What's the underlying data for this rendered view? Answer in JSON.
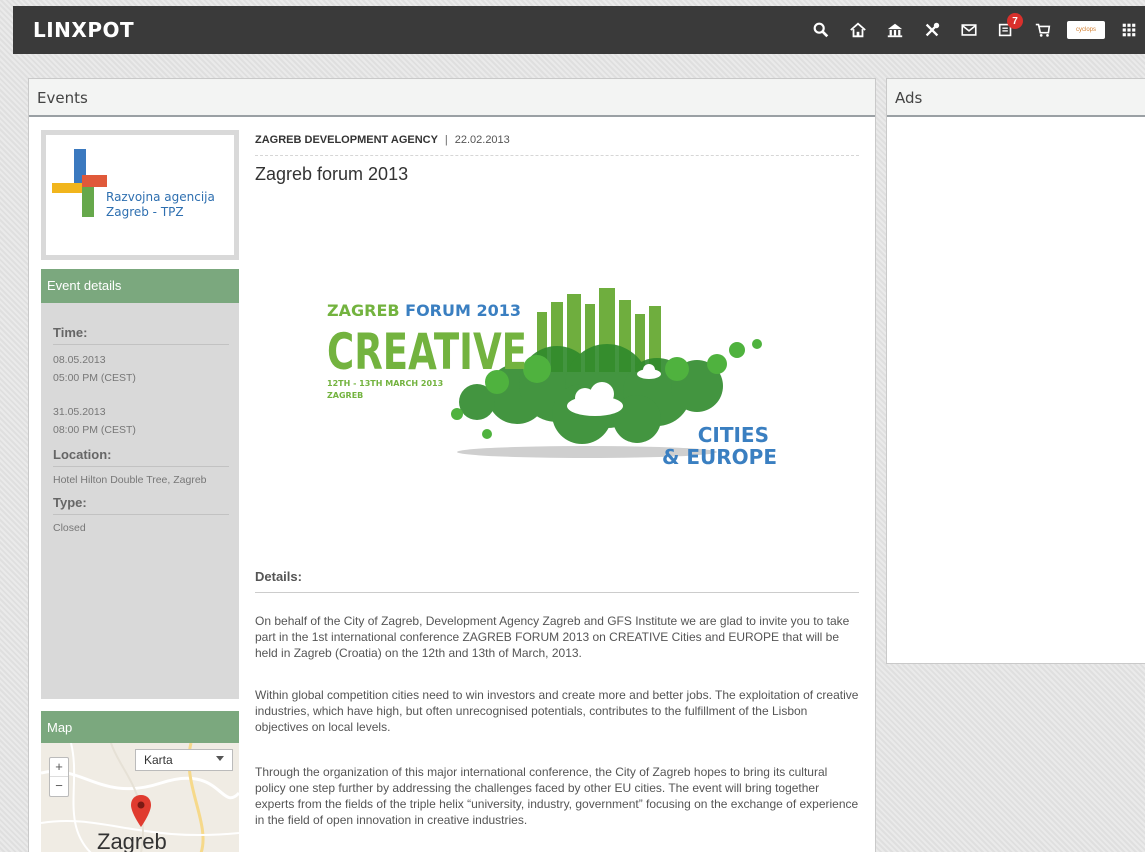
{
  "app": {
    "logo": "LINXPOT"
  },
  "topbar": {
    "icons": [
      "search-icon",
      "home-icon",
      "company-icon",
      "tools-icon",
      "mail-icon",
      "notifications-icon",
      "cart-icon",
      "cyclops-app",
      "apps-grid-icon"
    ],
    "notification_count": "7",
    "cyclops_label": "cyclops"
  },
  "events_panel": {
    "title": "Events",
    "organization_logo_text": [
      "Razvojna agencija",
      "Zagreb - TPZ"
    ],
    "event_details": {
      "heading": "Event details",
      "time_label": "Time:",
      "start_date": "08.05.2013",
      "start_time": "05:00 PM (CEST)",
      "end_date": "31.05.2013",
      "end_time": "08:00 PM (CEST)",
      "location_label": "Location:",
      "location_value": "Hotel Hilton Double Tree, Zagreb",
      "type_label": "Type:",
      "type_value": "Closed"
    },
    "map": {
      "heading": "Map",
      "zoom_in": "+",
      "zoom_out": "−",
      "map_type_selected": "Karta",
      "city_label": "Zagreb"
    },
    "article": {
      "organizer": "ZAGREB DEVELOPMENT AGENCY",
      "separator": "|",
      "date": "22.02.2013",
      "title": "Zagreb forum 2013",
      "banner": {
        "line1a": "ZAGREB ",
        "line1b": "FORUM 2013",
        "big": "CREATIVE",
        "dates": "12TH - 13TH MARCH 2013",
        "place": "ZAGREB",
        "cities": "CITIES",
        "europe": "& EUROPE"
      },
      "details_heading": "Details:",
      "paragraphs": [
        "On behalf of the City of Zagreb, Development Agency Zagreb and GFS Institute we are glad to invite you to take part in the 1st international conference ZAGREB FORUM 2013 on CREATIVE Cities and EUROPE that will be held in Zagreb (Croatia) on the 12th and 13th of March, 2013.",
        "Within global competition cities need to win investors and create more and better jobs. The exploitation of creative industries, which have high, but often unrecognised potentials, contributes to the fulfillment of the Lisbon objectives on local levels.",
        "Through the organization of this major international conference, the City of Zagreb hopes to bring its cultural policy one step further by addressing the challenges faced by other EU cities. The event will bring together experts from the fields of the triple helix “university, industry, government” focusing on the exchange of experience in the field of open innovation in creative industries."
      ]
    }
  },
  "ads_panel": {
    "title": "Ads"
  },
  "colors": {
    "topbar": "#3a3a3a",
    "accent_green": "#7ba87e",
    "badge_red": "#d9302c"
  }
}
